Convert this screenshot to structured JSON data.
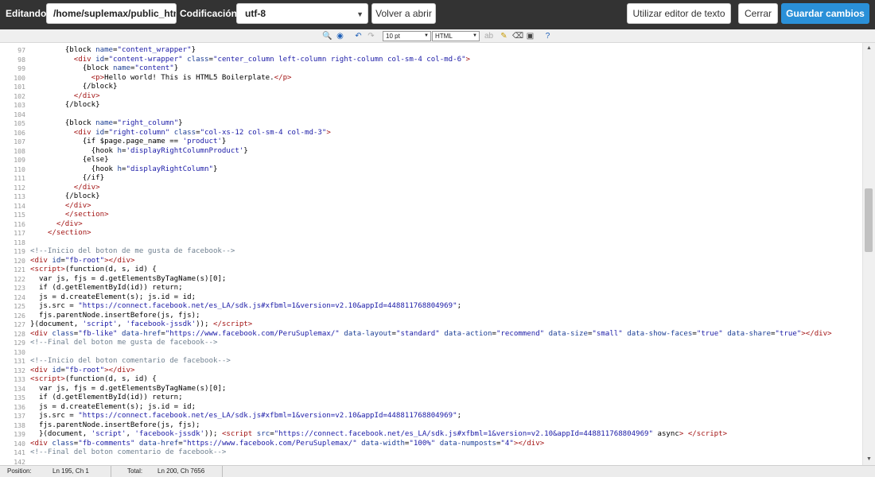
{
  "topbar": {
    "editing_label": "Editando:",
    "path_value": "/home/suplemax/public_html/themes/…",
    "encoding_label": "Codificación:",
    "encoding_value": "utf-8",
    "reopen_label": "Volver a abrir",
    "text_editor_label": "Utilizar editor de texto",
    "close_label": "Cerrar",
    "save_label": "Guardar cambios"
  },
  "toolbar": {
    "font_size": "10 pt",
    "syntax": "HTML"
  },
  "editor": {
    "lines": [
      {
        "n": "97",
        "html": "        {block <span class=\"at\">name</span>=<span class=\"sv\">\"content_wrapper\"</span>}"
      },
      {
        "n": "98",
        "html": "          <span class=\"tg\">&lt;div</span> <span class=\"at\">id</span>=<span class=\"sv\">\"content-wrapper\"</span> <span class=\"at\">class</span>=<span class=\"sv\">\"center_column left-column right-column col-sm-4 col-md-6\"</span><span class=\"tg\">&gt;</span>"
      },
      {
        "n": "99",
        "html": "            {block <span class=\"at\">name</span>=<span class=\"sv\">\"content\"</span>}"
      },
      {
        "n": "100",
        "html": "              <span class=\"tg\">&lt;p&gt;</span>Hello world! This is HTML5 Boilerplate.<span class=\"tg\">&lt;/p&gt;</span>"
      },
      {
        "n": "101",
        "html": "            {/block}"
      },
      {
        "n": "102",
        "html": "          <span class=\"tg\">&lt;/div&gt;</span>"
      },
      {
        "n": "103",
        "html": "        {/block}"
      },
      {
        "n": "104",
        "html": ""
      },
      {
        "n": "105",
        "html": "        {block <span class=\"at\">name</span>=<span class=\"sv\">\"right_column\"</span>}"
      },
      {
        "n": "106",
        "html": "          <span class=\"tg\">&lt;div</span> <span class=\"at\">id</span>=<span class=\"sv\">\"right-column\"</span> <span class=\"at\">class</span>=<span class=\"sv\">\"col-xs-12 col-sm-4 col-md-3\"</span><span class=\"tg\">&gt;</span>"
      },
      {
        "n": "107",
        "html": "            {if $page.page_name == <span class=\"sv\">'product'</span>}"
      },
      {
        "n": "108",
        "html": "              {hook <span class=\"at\">h</span>=<span class=\"sv\">'displayRightColumnProduct'</span>}"
      },
      {
        "n": "109",
        "html": "            {else}"
      },
      {
        "n": "110",
        "html": "              {hook <span class=\"at\">h</span>=<span class=\"sv\">\"displayRightColumn\"</span>}"
      },
      {
        "n": "111",
        "html": "            {/if}"
      },
      {
        "n": "112",
        "html": "          <span class=\"tg\">&lt;/div&gt;</span>"
      },
      {
        "n": "113",
        "html": "        {/block}"
      },
      {
        "n": "114",
        "html": "        <span class=\"tg\">&lt;/div&gt;</span>"
      },
      {
        "n": "115",
        "html": "        <span class=\"tg\">&lt;/section&gt;</span>"
      },
      {
        "n": "116",
        "html": "      <span class=\"tg\">&lt;/div&gt;</span>"
      },
      {
        "n": "117",
        "html": "    <span class=\"tg\">&lt;/section&gt;</span>"
      },
      {
        "n": "118",
        "html": ""
      },
      {
        "n": "119",
        "html": "<span class=\"cm\">&lt;!--Inicio del boton de me gusta de facebook--&gt;</span>"
      },
      {
        "n": "120",
        "html": "<span class=\"tg\">&lt;div</span> <span class=\"at\">id</span>=<span class=\"sv\">\"fb-root\"</span><span class=\"tg\">&gt;&lt;/div&gt;</span>"
      },
      {
        "n": "121",
        "html": "<span class=\"tg\">&lt;script&gt;</span>(function(d, s, id) {"
      },
      {
        "n": "122",
        "html": "  var js, fjs = d.getElementsByTagName(s)[0];"
      },
      {
        "n": "123",
        "html": "  if (d.getElementById(id)) return;"
      },
      {
        "n": "124",
        "html": "  js = d.createElement(s); js.id = id;"
      },
      {
        "n": "125",
        "html": "  js.src = <span class=\"sv\">\"https://connect.facebook.net/es_LA/sdk.js#xfbml=1&amp;version=v2.10&amp;appId=448811768804969\"</span>;"
      },
      {
        "n": "126",
        "html": "  fjs.parentNode.insertBefore(js, fjs);"
      },
      {
        "n": "127",
        "html": "}(document, <span class=\"sv\">'script'</span>, <span class=\"sv\">'facebook-jssdk'</span>)); <span class=\"tg\">&lt;/script&gt;</span>"
      },
      {
        "n": "128",
        "html": "<span class=\"tg\">&lt;div</span> <span class=\"at\">class</span>=<span class=\"sv\">\"fb-like\"</span> <span class=\"at\">data-href</span>=<span class=\"sv\">\"https://www.facebook.com/PeruSuplemax/\"</span> <span class=\"at\">data-layout</span>=<span class=\"sv\">\"standard\"</span> <span class=\"at\">data-action</span>=<span class=\"sv\">\"recommend\"</span> <span class=\"at\">data-size</span>=<span class=\"sv\">\"small\"</span> <span class=\"at\">data-show-faces</span>=<span class=\"sv\">\"true\"</span> <span class=\"at\">data-share</span>=<span class=\"sv\">\"true\"</span><span class=\"tg\">&gt;&lt;/div&gt;</span>"
      },
      {
        "n": "129",
        "html": "<span class=\"cm\">&lt;!--Final del boton me gusta de facebook--&gt;</span>"
      },
      {
        "n": "130",
        "html": ""
      },
      {
        "n": "131",
        "html": "<span class=\"cm\">&lt;!--Inicio del boton comentario de facebook--&gt;</span>"
      },
      {
        "n": "132",
        "html": "<span class=\"tg\">&lt;div</span> <span class=\"at\">id</span>=<span class=\"sv\">\"fb-root\"</span><span class=\"tg\">&gt;&lt;/div&gt;</span>"
      },
      {
        "n": "133",
        "html": "<span class=\"tg\">&lt;script&gt;</span>(function(d, s, id) {"
      },
      {
        "n": "134",
        "html": "  var js, fjs = d.getElementsByTagName(s)[0];"
      },
      {
        "n": "135",
        "html": "  if (d.getElementById(id)) return;"
      },
      {
        "n": "136",
        "html": "  js = d.createElement(s); js.id = id;"
      },
      {
        "n": "137",
        "html": "  js.src = <span class=\"sv\">\"https://connect.facebook.net/es_LA/sdk.js#xfbml=1&amp;version=v2.10&amp;appId=448811768804969\"</span>;"
      },
      {
        "n": "138",
        "html": "  fjs.parentNode.insertBefore(js, fjs);"
      },
      {
        "n": "139",
        "html": "  }(document, <span class=\"sv\">'script'</span>, <span class=\"sv\">'facebook-jssdk'</span>)); <span class=\"tg\">&lt;script</span> <span class=\"at\">src</span>=<span class=\"sv\">\"https://connect.facebook.net/es_LA/sdk.js#xfbml=1&amp;version=v2.10&amp;appId=448811768804969\"</span> async<span class=\"tg\">&gt;</span> <span class=\"tg\">&lt;/script&gt;</span>"
      },
      {
        "n": "140",
        "html": "<span class=\"tg\">&lt;div</span> <span class=\"at\">class</span>=<span class=\"sv\">\"fb-comments\"</span> <span class=\"at\">data-href</span>=<span class=\"sv\">\"https://www.facebook.com/PeruSuplemax/\"</span> <span class=\"at\">data-width</span>=<span class=\"sv\">\"100%\"</span> <span class=\"at\">data-numposts</span>=<span class=\"sv\">\"4\"</span><span class=\"tg\">&gt;&lt;/div&gt;</span>"
      },
      {
        "n": "141",
        "html": "<span class=\"cm\">&lt;!--Final del boton comentario de facebook--&gt;</span>"
      },
      {
        "n": "142",
        "html": ""
      }
    ]
  },
  "statusbar": {
    "position_label": "Position:",
    "position_value": "Ln 195, Ch 1",
    "total_label": "Total:",
    "total_value": "Ln 200, Ch 7656"
  }
}
